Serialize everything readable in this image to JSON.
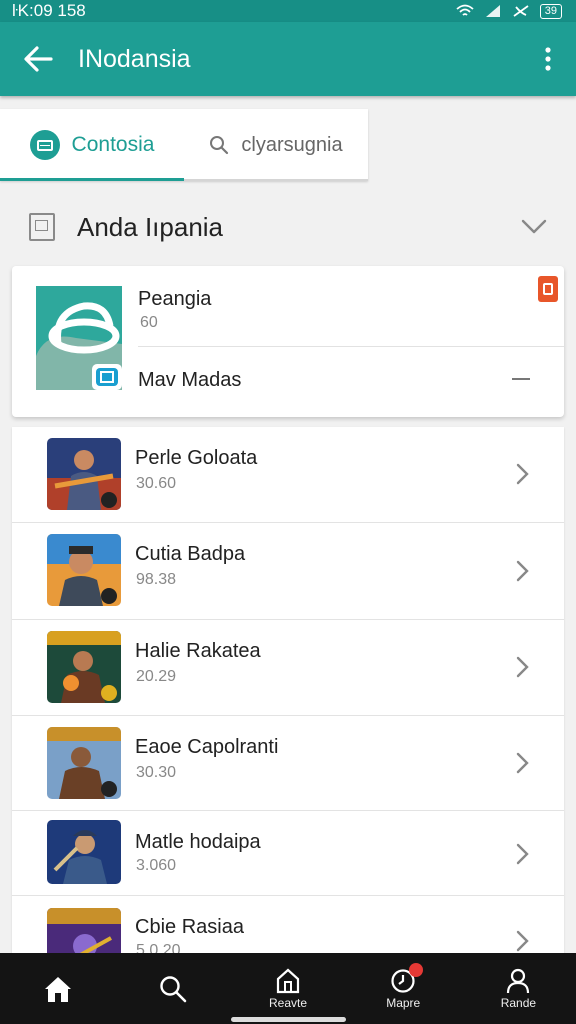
{
  "status_bar": {
    "time": "ŀK:09 158",
    "battery": "39"
  },
  "app_bar": {
    "title": "INodansia",
    "back_icon": "arrow-left-icon",
    "more_icon": "more-vert-icon"
  },
  "tabs": [
    {
      "label": "Contosia",
      "icon": "chat-bubble-icon",
      "active": true
    },
    {
      "label": "clyarsugnia",
      "icon": "search-icon",
      "active": false
    }
  ],
  "section": {
    "title": "Anda Iıpania",
    "icon": "document-icon",
    "toggle_icon": "chevron-down-icon"
  },
  "featured": {
    "name": "Peangia",
    "count": "60",
    "sub_label": "Mav Madas",
    "badge_icon": "notification-badge-icon",
    "colors": {
      "logo": "#2ea89c",
      "badge": "#e8562a"
    }
  },
  "items": [
    {
      "name": "Perle Goloata",
      "value": "30.60"
    },
    {
      "name": "Cutia Badpa",
      "value": "98.38"
    },
    {
      "name": "Halie Rakatea",
      "value": "20.29"
    },
    {
      "name": "Eaoe Capolranti",
      "value": "30.30"
    },
    {
      "name": "Matle hodaipa",
      "value": "3.060"
    },
    {
      "name": "Cbie Rasiaa",
      "value": "5.0.20"
    }
  ],
  "bottom_nav": [
    {
      "icon": "home-icon",
      "label": ""
    },
    {
      "icon": "search-icon",
      "label": ""
    },
    {
      "icon": "store-icon",
      "label": "Reavte"
    },
    {
      "icon": "clock-icon",
      "label": "Mapre"
    },
    {
      "icon": "person-icon",
      "label": "Rande"
    }
  ],
  "colors": {
    "primary": "#1e9e94",
    "status_bar": "#178f86",
    "background": "#f1f1f1",
    "nav_bg": "#141414"
  }
}
